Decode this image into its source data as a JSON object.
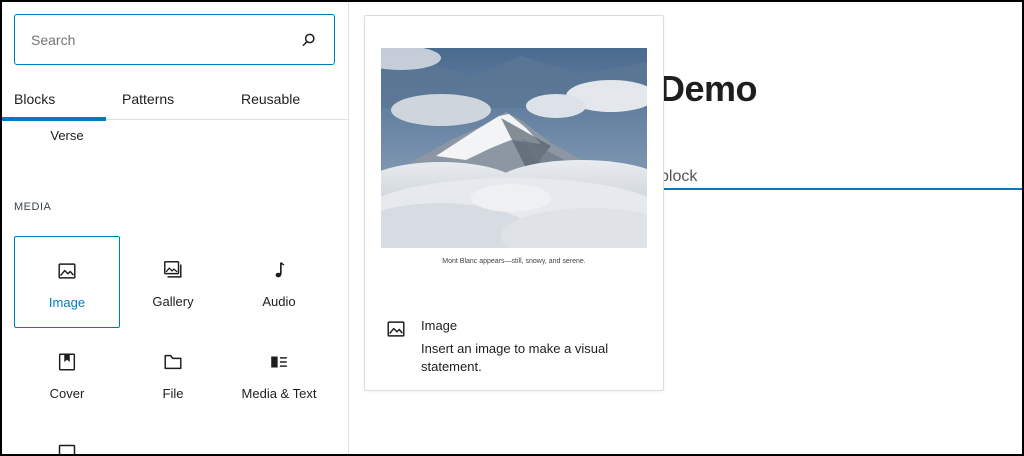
{
  "search": {
    "placeholder": "Search",
    "icon": "search-icon"
  },
  "tabs": [
    {
      "label": "Blocks",
      "active": true
    },
    {
      "label": "Patterns",
      "active": false
    },
    {
      "label": "Reusable",
      "active": false
    }
  ],
  "text_blocks": {
    "verse_label": "Verse"
  },
  "media": {
    "title": "MEDIA",
    "blocks": [
      {
        "label": "Image",
        "icon": "image-icon",
        "selected": true
      },
      {
        "label": "Gallery",
        "icon": "gallery-icon",
        "selected": false
      },
      {
        "label": "Audio",
        "icon": "audio-icon",
        "selected": false
      },
      {
        "label": "Cover",
        "icon": "cover-icon",
        "selected": false
      },
      {
        "label": "File",
        "icon": "file-icon",
        "selected": false
      },
      {
        "label": "Media & Text",
        "icon": "media-text-icon",
        "selected": false
      }
    ]
  },
  "preview": {
    "caption": "Mont Blanc appears—still, snowy, and serene.",
    "title": "Image",
    "description": "Insert an image to make a visual statement."
  },
  "canvas": {
    "title_fragment": "Demo",
    "placeholder_fragment": "block"
  },
  "colors": {
    "accent": "#007cba",
    "text": "#1e1e1e"
  }
}
